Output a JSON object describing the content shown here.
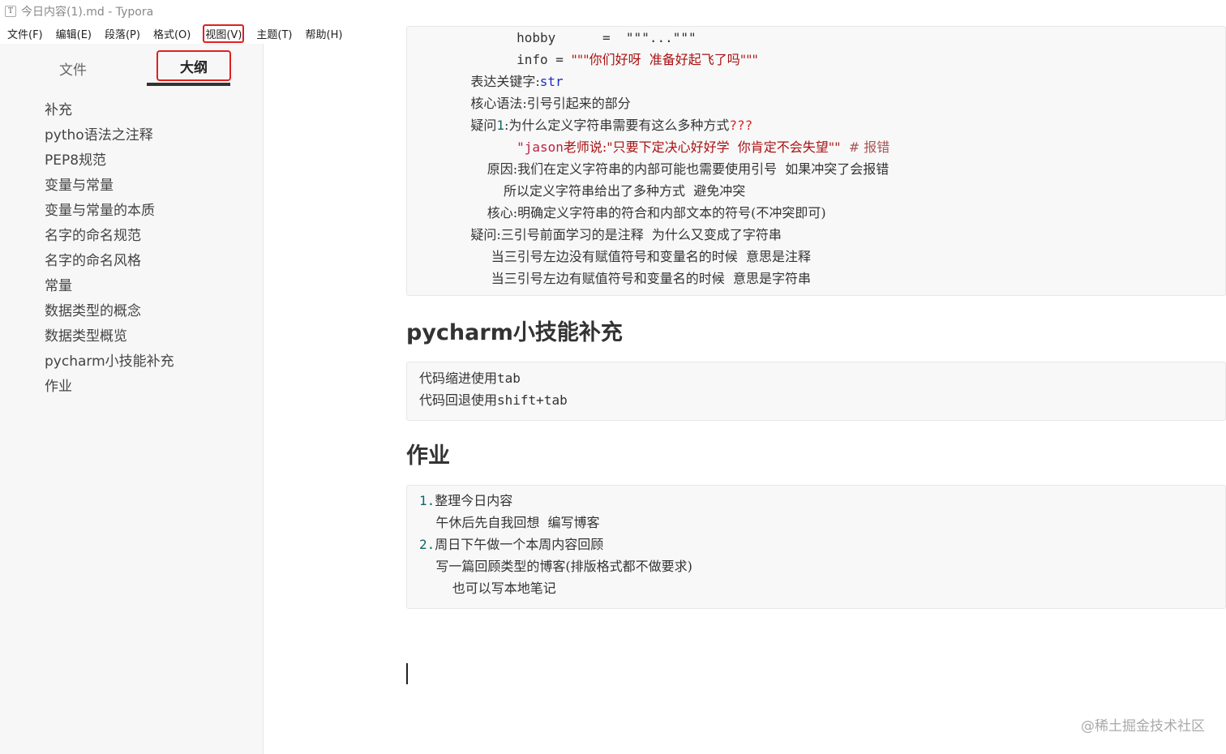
{
  "window": {
    "title": "今日内容(1).md - Typora",
    "app_icon": "T"
  },
  "menu": {
    "items": [
      "文件(F)",
      "编辑(E)",
      "段落(P)",
      "格式(O)",
      "视图(V)",
      "主题(T)",
      "帮助(H)"
    ]
  },
  "sidebar": {
    "tabs": {
      "files": "文件",
      "outline": "大纲"
    },
    "outline": [
      "补充",
      "pytho语法之注释",
      "PEP8规范",
      "变量与常量",
      "变量与常量的本质",
      "名字的命名规范",
      "名字的命名风格",
      "常量",
      "数据类型的概念",
      "数据类型概览",
      "pycharm小技能补充",
      "作业"
    ]
  },
  "editor": {
    "block1": {
      "line0": "        hobby      =  \"\"\"...\"\"\"",
      "line1_a": "        info = ",
      "line1_b": "\"\"\"你们好呀  准备好起飞了吗\"\"\"",
      "line2_a": "    表达关键字:",
      "line2_b": "str",
      "line3": "    核心语法:引号引起来的部分",
      "line4_a": "    疑问",
      "line4_b": "1",
      "line4_c": ":为什么定义字符串需要有这么多种方式",
      "line4_d": "???",
      "line5_a": "        \"jason",
      "line5_b": "老师说",
      "line5_c": ":\"只要下定决心好好学  你肯定不会失望\"\"",
      "line5_d": "  # 报错",
      "line6": "        原因:我们在定义字符串的内部可能也需要使用引号  如果冲突了会报错",
      "line7": "            所以定义字符串给出了多种方式  避免冲突",
      "line8": "        核心:明确定义字符串的符合和内部文本的符号(不冲突即可)",
      "line9": "    疑问:三引号前面学习的是注释  为什么又变成了字符串",
      "line10": "         当三引号左边没有赋值符号和变量名的时候  意思是注释",
      "line11": "         当三引号左边有赋值符号和变量名的时候  意思是字符串"
    },
    "heading1": "pycharm小技能补充",
    "block2": {
      "line1_a": "代码缩进使用",
      "line1_b": "tab",
      "line2_a": "代码回退使用",
      "line2_b": "shift+tab"
    },
    "heading2": "作业",
    "block3": {
      "line1_a": "1.",
      "line1_b": "整理今日内容",
      "line2": "    午休后先自我回想  编写博客",
      "line3_a": "2.",
      "line3_b": "周日下午做一个本周内容回顾",
      "line4": "    写一篇回顾类型的博客(排版格式都不做要求)",
      "line5": "        也可以写本地笔记"
    }
  },
  "watermark": "@稀土掘金技术社区"
}
